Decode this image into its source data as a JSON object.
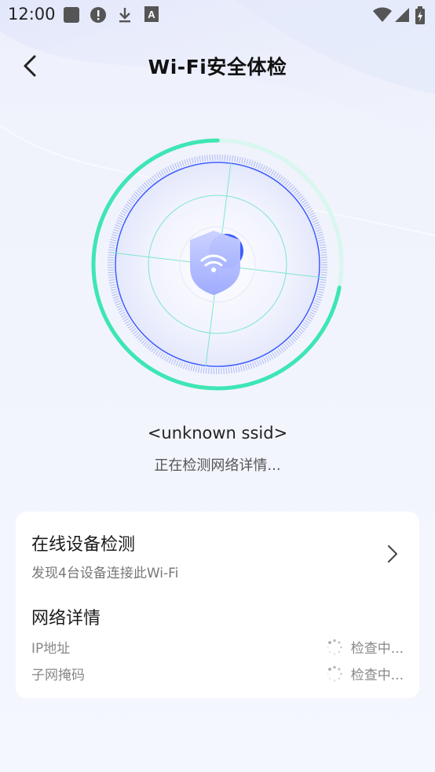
{
  "status_bar": {
    "time": "12:00",
    "left_icons": [
      "notification-square-icon",
      "alert-circle-icon",
      "download-icon",
      "keyboard-a-icon"
    ],
    "right_icons": [
      "wifi-signal-icon",
      "cellular-signal-icon",
      "battery-charging-icon"
    ]
  },
  "header": {
    "title": "Wi-Fi安全体检",
    "back_icon": "chevron-left-icon"
  },
  "scan": {
    "ssid": "<unknown ssid>",
    "status": "正在检测网络详情...",
    "progress": 0.28
  },
  "colors": {
    "accent_green": "#3ee6b4",
    "accent_blue": "#3d5cff",
    "card_bg": "#ffffff"
  },
  "devices": {
    "title": "在线设备检测",
    "subtitle": "发现4台设备连接此Wi-Fi",
    "chevron_icon": "chevron-right-icon"
  },
  "network": {
    "title": "网络详情",
    "rows": [
      {
        "label": "IP地址",
        "value": "检查中..."
      },
      {
        "label": "子网掩码",
        "value": "检查中..."
      }
    ]
  }
}
